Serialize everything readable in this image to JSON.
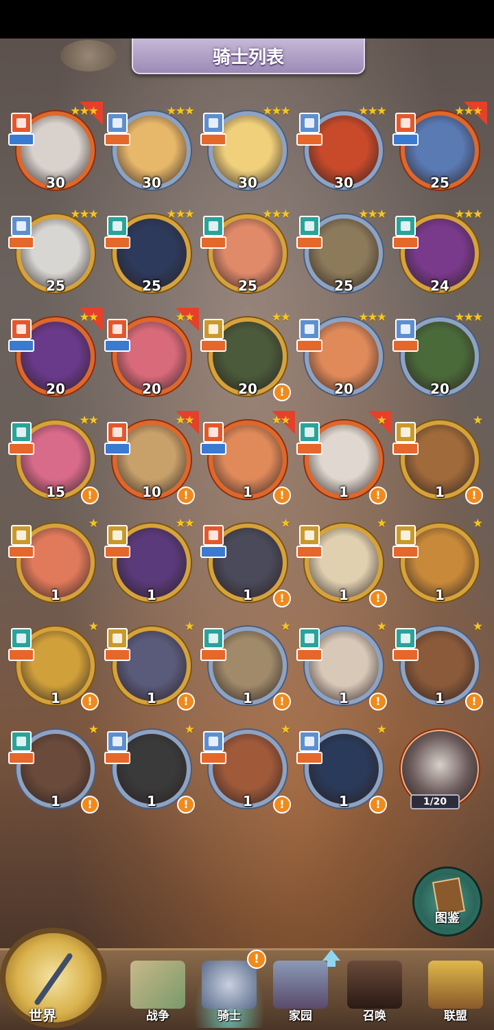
{
  "title": "骑士列表",
  "colors": {
    "gold_frame": "#d6a23a",
    "silver_frame": "#8da3c4",
    "red_frame": "#e0672a",
    "alert": "#f08a1c",
    "badge_red": "#e5572a",
    "badge_blue": "#5c8fd0",
    "badge_teal": "#2aa39a",
    "badge_gold": "#c99a2a"
  },
  "knights": [
    {
      "level": "30",
      "stars": "★★★",
      "frame": "red",
      "badge": "#e5572a",
      "upgrade": true,
      "alert": false,
      "face": "#d9d2cc"
    },
    {
      "level": "30",
      "stars": "★★★",
      "frame": "blue",
      "badge": "#5c8fd0",
      "upgrade": false,
      "alert": false,
      "face": "#e7b76a"
    },
    {
      "level": "30",
      "stars": "★★★",
      "frame": "blue",
      "badge": "#5c8fd0",
      "upgrade": false,
      "alert": false,
      "face": "#f0d07a"
    },
    {
      "level": "30",
      "stars": "★★★",
      "frame": "blue",
      "badge": "#5c8fd0",
      "upgrade": false,
      "alert": false,
      "face": "#c84a2a"
    },
    {
      "level": "25",
      "stars": "★★★",
      "frame": "red",
      "badge": "#e5572a",
      "upgrade": true,
      "alert": false,
      "face": "#5a7ab4"
    },
    {
      "level": "25",
      "stars": "★★★",
      "frame": "gold",
      "badge": "#5c8fd0",
      "upgrade": false,
      "alert": false,
      "face": "#d8d6d2"
    },
    {
      "level": "25",
      "stars": "★★★",
      "frame": "gold",
      "badge": "#2aa39a",
      "upgrade": false,
      "alert": false,
      "face": "#2d3a5c"
    },
    {
      "level": "25",
      "stars": "★★★",
      "frame": "gold",
      "badge": "#2aa39a",
      "upgrade": false,
      "alert": false,
      "face": "#e08a6a"
    },
    {
      "level": "25",
      "stars": "★★★",
      "frame": "blue",
      "badge": "#2aa39a",
      "upgrade": false,
      "alert": false,
      "face": "#8c7a5a"
    },
    {
      "level": "24",
      "stars": "★★★",
      "frame": "gold",
      "badge": "#2aa39a",
      "upgrade": false,
      "alert": false,
      "face": "#7a3a8c"
    },
    {
      "level": "20",
      "stars": "★★",
      "frame": "red",
      "badge": "#e5572a",
      "upgrade": true,
      "alert": false,
      "face": "#6a3a8a"
    },
    {
      "level": "20",
      "stars": "★★",
      "frame": "red",
      "badge": "#e5572a",
      "upgrade": true,
      "alert": false,
      "face": "#d86a7a"
    },
    {
      "level": "20",
      "stars": "★★",
      "frame": "gold",
      "badge": "#c99a2a",
      "upgrade": false,
      "alert": true,
      "face": "#4a5a3a"
    },
    {
      "level": "20",
      "stars": "★★★",
      "frame": "blue",
      "badge": "#5c8fd0",
      "upgrade": false,
      "alert": false,
      "face": "#e08a5a"
    },
    {
      "level": "20",
      "stars": "★★★",
      "frame": "blue",
      "badge": "#5c8fd0",
      "upgrade": false,
      "alert": false,
      "face": "#4a6a3a"
    },
    {
      "level": "15",
      "stars": "★★",
      "frame": "gold",
      "badge": "#2aa39a",
      "upgrade": false,
      "alert": true,
      "face": "#d86a8a"
    },
    {
      "level": "10",
      "stars": "★★",
      "frame": "red",
      "badge": "#e5572a",
      "upgrade": true,
      "alert": true,
      "face": "#c8a06a"
    },
    {
      "level": "1",
      "stars": "★★",
      "frame": "red",
      "badge": "#e5572a",
      "upgrade": true,
      "alert": true,
      "face": "#e08a5a"
    },
    {
      "level": "1",
      "stars": "★",
      "frame": "red",
      "badge": "#2aa39a",
      "upgrade": true,
      "alert": true,
      "face": "#e0d8d0"
    },
    {
      "level": "1",
      "stars": "★",
      "frame": "gold",
      "badge": "#c99a2a",
      "upgrade": false,
      "alert": true,
      "face": "#a06a3a"
    },
    {
      "level": "1",
      "stars": "★",
      "frame": "gold",
      "badge": "#c99a2a",
      "upgrade": false,
      "alert": false,
      "face": "#e07a5a"
    },
    {
      "level": "1",
      "stars": "★★",
      "frame": "gold",
      "badge": "#c99a2a",
      "upgrade": false,
      "alert": false,
      "face": "#5a3a7a"
    },
    {
      "level": "1",
      "stars": "★",
      "frame": "gold",
      "badge": "#e5572a",
      "upgrade": false,
      "alert": true,
      "face": "#4a4a5a"
    },
    {
      "level": "1",
      "stars": "★",
      "frame": "gold",
      "badge": "#c99a2a",
      "upgrade": false,
      "alert": true,
      "face": "#e0d0b0"
    },
    {
      "level": "1",
      "stars": "★",
      "frame": "gold",
      "badge": "#c99a2a",
      "upgrade": false,
      "alert": false,
      "face": "#c88a3a"
    },
    {
      "level": "1",
      "stars": "★",
      "frame": "gold",
      "badge": "#2aa39a",
      "upgrade": false,
      "alert": true,
      "face": "#d0a03a"
    },
    {
      "level": "1",
      "stars": "★",
      "frame": "gold",
      "badge": "#c99a2a",
      "upgrade": false,
      "alert": true,
      "face": "#5a5a7a"
    },
    {
      "level": "1",
      "stars": "★",
      "frame": "blue",
      "badge": "#2aa39a",
      "upgrade": false,
      "alert": true,
      "face": "#a08a6a"
    },
    {
      "level": "1",
      "stars": "★",
      "frame": "blue",
      "badge": "#2aa39a",
      "upgrade": false,
      "alert": true,
      "face": "#d8c8b8"
    },
    {
      "level": "1",
      "stars": "★",
      "frame": "blue",
      "badge": "#2aa39a",
      "upgrade": false,
      "alert": true,
      "face": "#8a5a3a"
    },
    {
      "level": "1",
      "stars": "★",
      "frame": "blue",
      "badge": "#2aa39a",
      "upgrade": false,
      "alert": true,
      "face": "#6a4a3a"
    },
    {
      "level": "1",
      "stars": "★",
      "frame": "blue",
      "badge": "#5c8fd0",
      "upgrade": false,
      "alert": true,
      "face": "#3a3a3a"
    },
    {
      "level": "1",
      "stars": "★",
      "frame": "blue",
      "badge": "#5c8fd0",
      "upgrade": false,
      "alert": true,
      "face": "#a05a3a"
    },
    {
      "level": "1",
      "stars": "★",
      "frame": "blue",
      "badge": "#5c8fd0",
      "upgrade": false,
      "alert": true,
      "face": "#2a3a5a"
    }
  ],
  "locked_knight": {
    "fragments": "1/20"
  },
  "codex": {
    "label": "图鉴"
  },
  "nav": {
    "world": "世界",
    "items": [
      {
        "label": "战争",
        "active": false
      },
      {
        "label": "骑士",
        "active": true
      },
      {
        "label": "家园",
        "active": false
      },
      {
        "label": "召唤",
        "active": false
      },
      {
        "label": "联盟",
        "active": false
      }
    ],
    "knights_alert": "!"
  }
}
